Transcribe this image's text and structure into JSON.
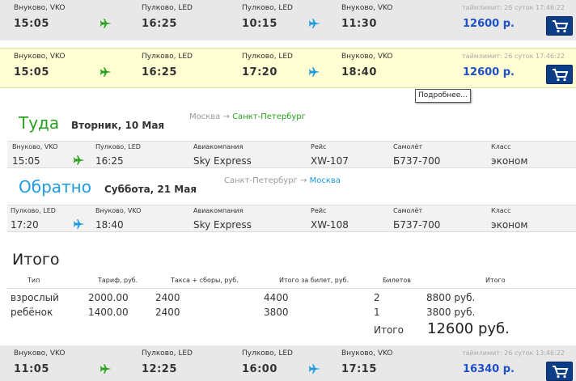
{
  "results": [
    {
      "dep1": {
        "city": "Внуково, VKO",
        "time": "15:05"
      },
      "arr1": {
        "city": "Пулково, LED",
        "time": "16:25"
      },
      "dep2": {
        "city": "Пулково, LED",
        "time": "10:15"
      },
      "arr2": {
        "city": "Внуково, VKO",
        "time": "11:30"
      },
      "limit": "таймлимит: 26 суток 17:46:22",
      "price": "12600 р."
    },
    {
      "dep1": {
        "city": "Внуково, VKO",
        "time": "15:05"
      },
      "arr1": {
        "city": "Пулково, LED",
        "time": "16:25"
      },
      "dep2": {
        "city": "Пулково, LED",
        "time": "17:20"
      },
      "arr2": {
        "city": "Внуково, VKO",
        "time": "18:40"
      },
      "limit": "таймлимит: 26 суток 17:46:22",
      "price": "12600 р."
    },
    {
      "dep1": {
        "city": "Внуково, VKO",
        "time": "11:05"
      },
      "arr1": {
        "city": "Пулково, LED",
        "time": "12:25"
      },
      "dep2": {
        "city": "Пулково, LED",
        "time": "16:00"
      },
      "arr2": {
        "city": "Внуково, VKO",
        "time": "17:15"
      },
      "limit": "таймлимит: 26 суток 13:46:22",
      "price": "16340 р."
    }
  ],
  "tooltip": "Подробнее...",
  "outbound": {
    "title": "Туда",
    "date": "Вторник, 10 Мая",
    "route_from": "Москва",
    "arrow": "→",
    "route_to": "Санкт-Петербург",
    "labels": {
      "dep": "Внуково, VKO",
      "arr": "Пулково, LED",
      "airline": "Авиакомпания",
      "flight": "Рейс",
      "aircraft": "Самолёт",
      "class": "Класс"
    },
    "values": {
      "dep": "15:05",
      "arr": "16:25",
      "airline": "Sky Express",
      "flight": "XW-107",
      "aircraft": "Б737-700",
      "class": "эконом"
    }
  },
  "inbound": {
    "title": "Обратно",
    "date": "Суббота, 21 Мая",
    "route_from": "Санкт-Петербург",
    "arrow": "→",
    "route_to": "Москва",
    "labels": {
      "dep": "Пулково, LED",
      "arr": "Внуково, VKO",
      "airline": "Авиакомпания",
      "flight": "Рейс",
      "aircraft": "Самолёт",
      "class": "Класс"
    },
    "values": {
      "dep": "17:20",
      "arr": "18:40",
      "airline": "Sky Express",
      "flight": "XW-108",
      "aircraft": "Б737-700",
      "class": "эконом"
    }
  },
  "totals": {
    "title": "Итого",
    "headers": [
      "Тип",
      "Тариф, руб.",
      "Такса + сборы, руб.",
      "Итого за билет, руб.",
      "Билетов",
      "Итого"
    ],
    "rows": [
      {
        "type": "взрослый",
        "fare": "2000.00",
        "tax": "2400",
        "per_ticket": "4400",
        "count": "2",
        "sum": "8800 руб."
      },
      {
        "type": "ребёнок",
        "fare": "1400.00",
        "tax": "2400",
        "per_ticket": "3800",
        "count": "1",
        "sum": "3800 руб."
      }
    ],
    "total_label": "Итого",
    "total_sum": "12600 руб."
  },
  "colors": {
    "green_plane": "#28a21c",
    "blue_plane": "#1d9be0",
    "price": "#1e50c8",
    "cart": "#0b3e86",
    "highlight": "#fffdd2"
  },
  "icons": {
    "outbound": "plane-right-icon",
    "inbound": "plane-right-icon",
    "cart": "cart-icon"
  }
}
